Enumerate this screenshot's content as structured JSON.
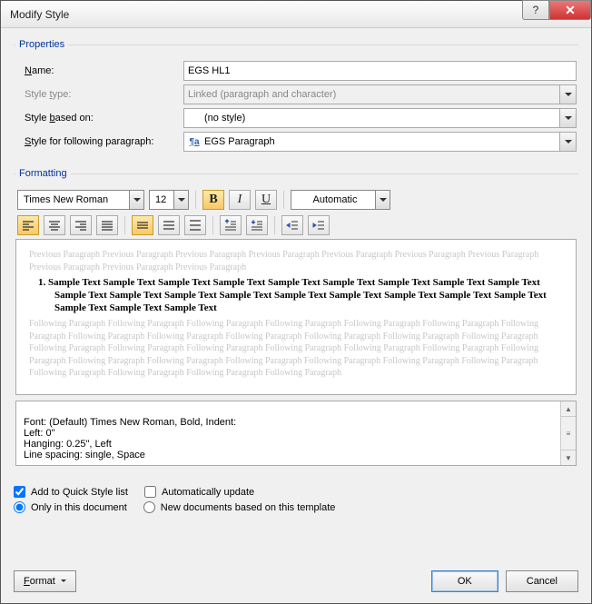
{
  "window": {
    "title": "Modify Style",
    "help": "?",
    "close": "✕"
  },
  "properties": {
    "legend": "Properties",
    "name_label": "Name:",
    "name_value": "EGS HL1",
    "styletype_label": "Style type:",
    "styletype_value": "Linked (paragraph and character)",
    "basedon_label": "Style based on:",
    "basedon_value": "(no style)",
    "following_label": "Style for following paragraph:",
    "following_value": "EGS Paragraph",
    "para_icon": "¶a"
  },
  "formatting": {
    "legend": "Formatting",
    "font": "Times New Roman",
    "size": "12",
    "color": "Automatic",
    "bold": "B",
    "italic": "I",
    "underline": "U"
  },
  "preview": {
    "ghost_prev": "Previous Paragraph Previous Paragraph Previous Paragraph Previous Paragraph Previous Paragraph Previous Paragraph Previous Paragraph Previous Paragraph Previous Paragraph Previous Paragraph",
    "sample": "1.   Sample Text Sample Text Sample Text Sample Text Sample Text Sample Text Sample Text Sample Text Sample Text Sample Text Sample Text Sample Text Sample Text Sample Text Sample Text Sample Text Sample Text Sample Text Sample Text Sample Text Sample Text",
    "ghost_next": "Following Paragraph Following Paragraph Following Paragraph Following Paragraph Following Paragraph Following Paragraph Following Paragraph Following Paragraph Following Paragraph Following Paragraph Following Paragraph Following Paragraph Following Paragraph Following Paragraph Following Paragraph Following Paragraph Following Paragraph Following Paragraph Following Paragraph Following Paragraph Following Paragraph Following Paragraph Following Paragraph Following Paragraph Following Paragraph Following Paragraph Following Paragraph Following Paragraph Following Paragraph Following Paragraph"
  },
  "description": "Font: (Default) Times New Roman, Bold, Indent:\n    Left:  0\"\n    Hanging:  0.25\", Left\n    Line spacing:  single, Space",
  "options": {
    "quickstyle": "Add to Quick Style list",
    "autoupdate": "Automatically update",
    "onlydoc": "Only in this document",
    "newdocs": "New documents based on this template"
  },
  "buttons": {
    "format": "Format",
    "ok": "OK",
    "cancel": "Cancel"
  }
}
